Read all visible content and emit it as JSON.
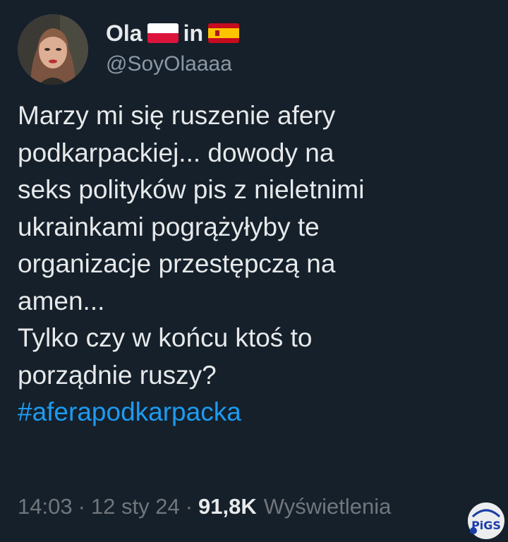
{
  "tweet": {
    "author_name": "Ola",
    "author_handle": "@SoyOlaaaa",
    "name_connector": "in",
    "flags": [
      "poland-flag-icon",
      "spain-flag-icon"
    ],
    "body_lines": [
      "Marzy mi się ruszenie afery",
      "podkarpackiej... dowody na",
      "seks polityków pis z nieletnimi",
      "ukrainkami pogrążyłyby te",
      "organizacje przestępczą na",
      "amen...",
      "Tylko czy w końcu ktoś to",
      "porządnie ruszy?"
    ],
    "hashtag": "#aferapodkarpacka",
    "time": "14:03",
    "date": "12 sty 24",
    "views_count": "91,8K",
    "views_label": "Wyświetlenia",
    "separator": "·"
  },
  "colors": {
    "background": "#15202b",
    "text": "#e7e9ea",
    "muted": "#71767b",
    "link": "#1d9bf0"
  },
  "watermark": {
    "text": "PiGS"
  }
}
